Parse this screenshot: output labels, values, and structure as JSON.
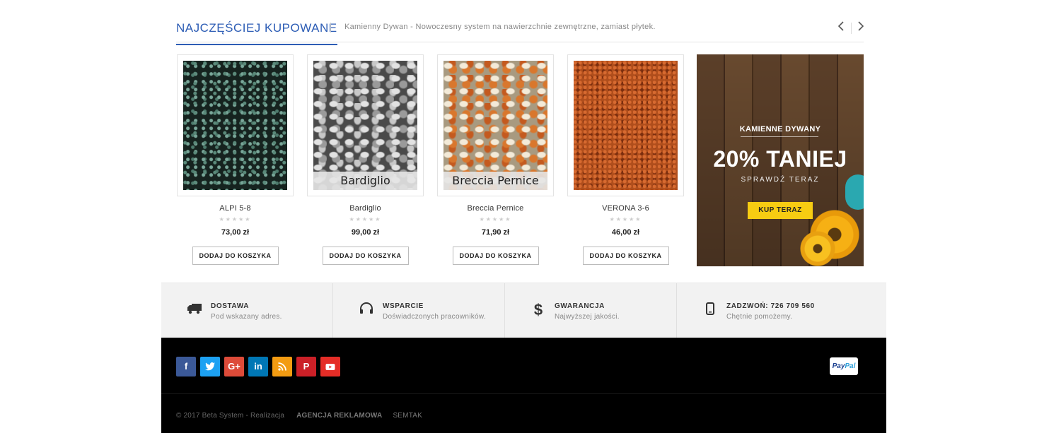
{
  "section": {
    "title": "NAJCZĘŚCIEJ KUPOWANE",
    "subtitle": "Kamienny Dywan - Nowoczesny system na nawierzchnie zewnętrzne, zamiast płytek.",
    "prev_icon": "chevron-left-icon",
    "next_icon": "chevron-right-icon"
  },
  "products": [
    {
      "name": "ALPI 5-8",
      "price": "73,00 zł",
      "image_label": "",
      "button": "DODAJ DO KOSZYKA",
      "rating": 0
    },
    {
      "name": "Bardiglio",
      "price": "99,00 zł",
      "image_label": "Bardiglio",
      "button": "DODAJ DO KOSZYKA",
      "rating": 0
    },
    {
      "name": "Breccia Pernice",
      "price": "71,90 zł",
      "image_label": "Breccia Pernice",
      "button": "DODAJ DO KOSZYKA",
      "rating": 0
    },
    {
      "name": "VERONA 3-6",
      "price": "46,00 zł",
      "image_label": "",
      "button": "DODAJ DO KOSZYKA",
      "rating": 0
    }
  ],
  "banner": {
    "kicker": "KAMIENNE DYWANY",
    "title": "20% TANIEJ",
    "subtitle": "SPRAWDŹ TERAZ",
    "button": "KUP TERAZ"
  },
  "features": [
    {
      "icon": "truck-icon",
      "title": "DOSTAWA",
      "desc": "Pod wskazany adres."
    },
    {
      "icon": "headset-icon",
      "title": "WSPARCIE",
      "desc": "Doświadczonych pracowników."
    },
    {
      "icon": "dollar-icon",
      "title": "GWARANCJA",
      "desc": "Najwyższej jakości."
    },
    {
      "icon": "phone-icon",
      "title": "ZADZWOŃ:",
      "title_value": "726 709 560",
      "desc": "Chętnie pomożemy."
    }
  ],
  "footer": {
    "socials": [
      {
        "name": "facebook",
        "glyph": "f",
        "color": "#3b5998"
      },
      {
        "name": "twitter",
        "glyph": "🐦",
        "color": "#1da1f2"
      },
      {
        "name": "google-plus",
        "glyph": "G+",
        "color": "#dd4b39"
      },
      {
        "name": "linkedin",
        "glyph": "in",
        "color": "#0077b5"
      },
      {
        "name": "rss",
        "glyph": "◉",
        "color": "#f39c12"
      },
      {
        "name": "pinterest",
        "glyph": "P",
        "color": "#cb2027"
      },
      {
        "name": "youtube",
        "glyph": "▶",
        "color": "#e52d27"
      }
    ],
    "paypal_a": "Pay",
    "paypal_b": "Pal",
    "copyright": "© 2017 Beta System - Realizacja",
    "agency": "AGENCJA REKLAMOWA",
    "semtak": "SEMTAK"
  }
}
